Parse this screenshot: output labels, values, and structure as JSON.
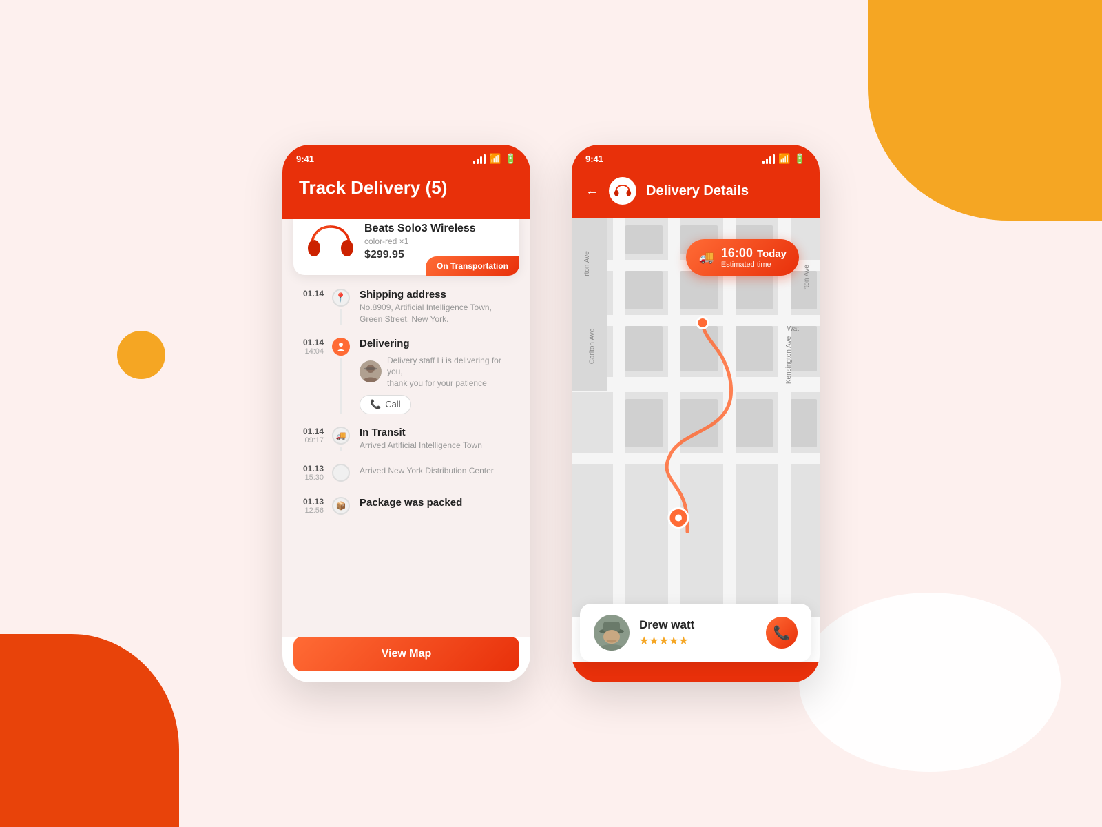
{
  "background": {
    "color": "#fdf0ee"
  },
  "phone1": {
    "status_time": "9:41",
    "header_title": "Track Delivery  (5)",
    "product": {
      "name": "Beats Solo3 Wireless",
      "variant": "color-red  ×1",
      "price": "$299.95",
      "badge": "On Transportation"
    },
    "timeline": [
      {
        "date": "01.14",
        "time": "",
        "title": "Shipping address",
        "sub": "No.8909, Artificial Intelligence Town,\nGreen Street, New York.",
        "icon_type": "location"
      },
      {
        "date": "01.14",
        "time": "14:04",
        "title": "Delivering",
        "sub": "Delivery staff Li is delivering for you,\nthank you for your patience",
        "icon_type": "person",
        "call_label": "Call"
      },
      {
        "date": "01.14",
        "time": "09:17",
        "title": "In Transit",
        "sub": "Arrived Artificial Intelligence Town",
        "icon_type": "truck"
      },
      {
        "date": "01.13",
        "time": "15:30",
        "title": "",
        "sub": "Arrived New York Distribution Center",
        "icon_type": "dot"
      },
      {
        "date": "01.13",
        "time": "12:56",
        "title": "Package was packed",
        "sub": "",
        "icon_type": "box"
      }
    ],
    "view_map_btn": "View Map"
  },
  "phone2": {
    "status_time": "9:41",
    "header_title": "Delivery Details",
    "back_label": "←",
    "map": {
      "streets": [
        "Carlton Ave",
        "Kensington Ave",
        "Wat"
      ],
      "eta_time": "16:00",
      "eta_day": "Today",
      "eta_label": "Estimated time"
    },
    "driver": {
      "name": "Drew watt",
      "stars": 5,
      "call_icon": "📞"
    }
  }
}
